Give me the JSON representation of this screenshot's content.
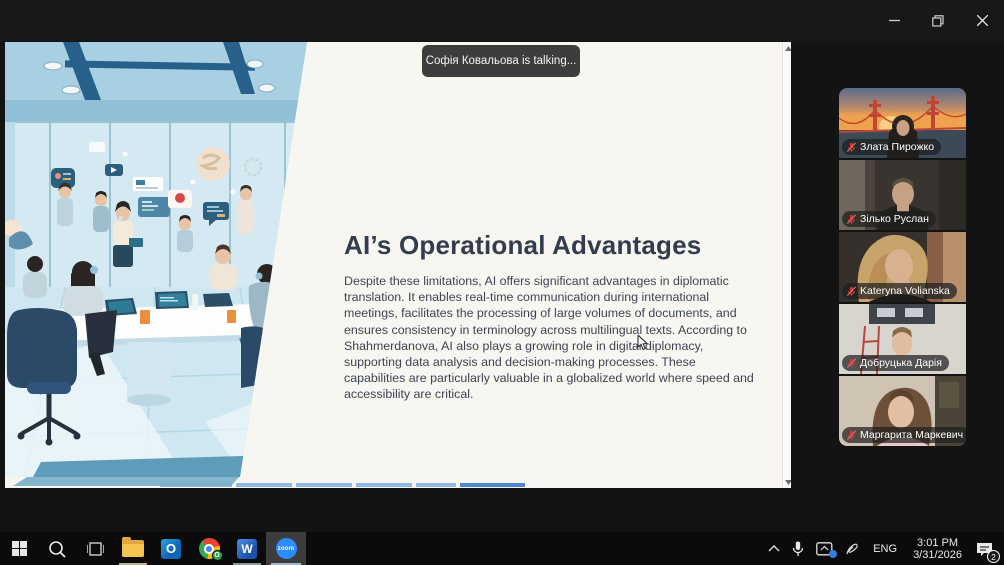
{
  "window": {
    "app": "Zoom meeting - shared screen",
    "controls": {
      "minimize": "minimize",
      "restore": "restore",
      "close": "close"
    }
  },
  "notification": {
    "text": "Софія Ковальова is talking..."
  },
  "slide": {
    "title": "AI’s Operational Advantages",
    "body": "Despite these limitations, AI offers significant advantages in diplomatic translation. It enables real-time communication during international meetings, facilitates the processing of large volumes of documents, and ensures consistency in terminology across multilingual texts. According to Shahmerdanova, AI also plays a growing role in digital diplomacy, supporting data analysis and decision-making processes. These capabilities are particularly valuable in a globalized world where speed and accessibility are critical."
  },
  "participants": [
    {
      "name": "Злата Пирожко",
      "muted": true
    },
    {
      "name": "Зілько Руслан",
      "muted": true
    },
    {
      "name": "Kateryna Volianska",
      "muted": true
    },
    {
      "name": "Добруцька Дарія",
      "muted": true
    },
    {
      "name": "Маргарита Маркевич",
      "muted": true
    }
  ],
  "taskbar": {
    "zoom_label": "zoom",
    "outlook_letter": "O",
    "word_letter": "W",
    "tray": {
      "language": "ENG",
      "time": "3:01 PM",
      "date": "3/31/2026",
      "notification_count": "2"
    }
  },
  "colors": {
    "taskbar_bg": "#0b0b0b",
    "titlebar_bg": "#181818",
    "desktop_bg": "#131313",
    "slide_bg": "#f8f6f1",
    "slide_text": "#3c4454",
    "accent_zoom_blue": "#2d8cff",
    "muted_mic_red": "#d23a3a",
    "notification_pill": "#3d3d3d"
  }
}
